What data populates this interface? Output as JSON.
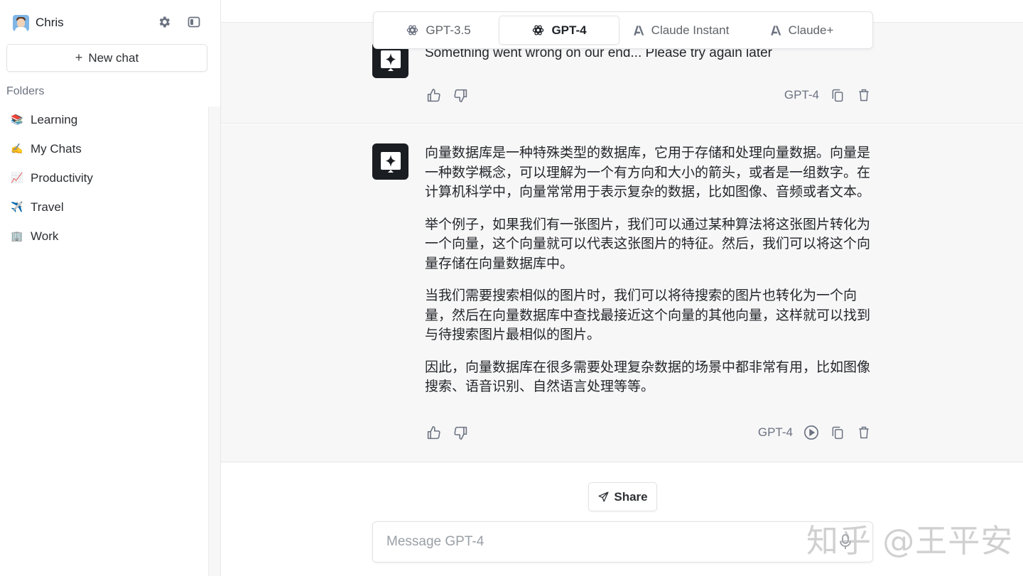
{
  "user": {
    "name": "Chris"
  },
  "sidebar": {
    "new_chat_label": "New chat",
    "folders_label": "Folders",
    "folders": [
      {
        "emoji": "📚",
        "label": "Learning"
      },
      {
        "emoji": "✍️",
        "label": "My Chats"
      },
      {
        "emoji": "📈",
        "label": "Productivity"
      },
      {
        "emoji": "✈️",
        "label": "Travel"
      },
      {
        "emoji": "🏢",
        "label": "Work"
      }
    ]
  },
  "models": {
    "selected": "GPT-4",
    "tabs": [
      {
        "label": "GPT-3.5",
        "icon": "openai-icon"
      },
      {
        "label": "GPT-4",
        "icon": "openai-icon"
      },
      {
        "label": "Claude Instant",
        "icon": "anthropic-icon"
      },
      {
        "label": "Claude+",
        "icon": "anthropic-icon"
      }
    ]
  },
  "messages": [
    {
      "paragraphs": [
        "Something went wrong on our end... Please try again later"
      ],
      "model": "GPT-4"
    },
    {
      "paragraphs": [
        "向量数据库是一种特殊类型的数据库，它用于存储和处理向量数据。向量是一种数学概念，可以理解为一个有方向和大小的箭头，或者是一组数字。在计算机科学中，向量常常用于表示复杂的数据，比如图像、音频或者文本。",
        "举个例子，如果我们有一张图片，我们可以通过某种算法将这张图片转化为一个向量，这个向量就可以代表这张图片的特征。然后，我们可以将这个向量存储在向量数据库中。",
        "当我们需要搜索相似的图片时，我们可以将待搜索的图片也转化为一个向量，然后在向量数据库中查找最接近这个向量的其他向量，这样就可以找到与待搜索图片最相似的图片。",
        "因此，向量数据库在很多需要处理复杂数据的场景中都非常有用，比如图像搜索、语音识别、自然语言处理等等。"
      ],
      "model": "GPT-4"
    }
  ],
  "share_label": "Share",
  "composer": {
    "placeholder": "Message GPT-4",
    "value": ""
  },
  "watermark": "知乎 @王平安"
}
